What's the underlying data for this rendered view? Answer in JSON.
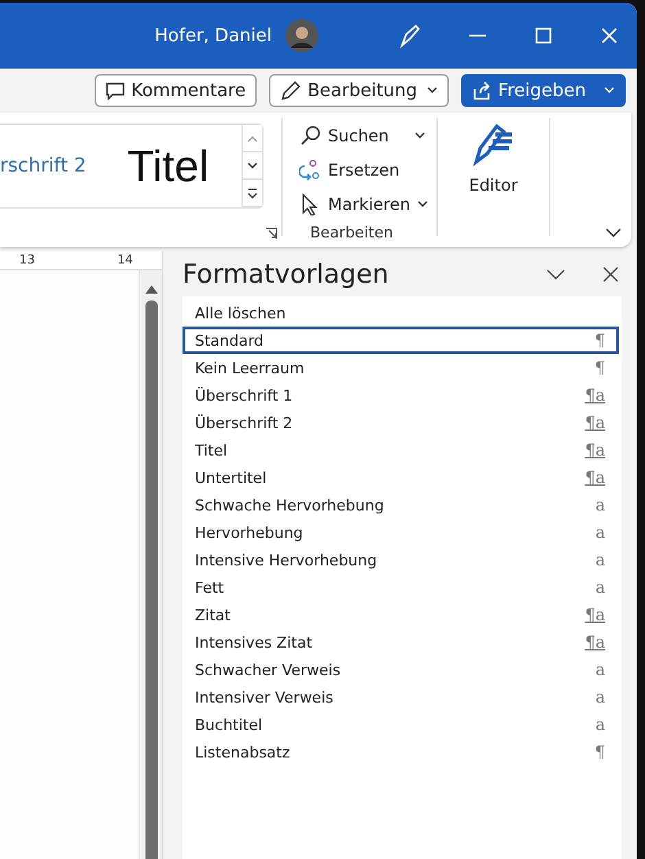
{
  "titlebar": {
    "user": "Hofer, Daniel"
  },
  "commands": [
    {
      "label": "Kommentare",
      "kind": "comments"
    },
    {
      "label": "Bearbeitung",
      "kind": "editing"
    },
    {
      "label": "Freigeben",
      "kind": "share"
    }
  ],
  "ribbon": {
    "gallery": [
      {
        "label": "rschrift 2",
        "kind": "heading"
      },
      {
        "label": "Titel",
        "kind": "title"
      }
    ],
    "edit_group": {
      "items": [
        {
          "label": "Suchen",
          "kind": "find",
          "dropdown": true
        },
        {
          "label": "Ersetzen",
          "kind": "replace",
          "dropdown": false
        },
        {
          "label": "Markieren",
          "kind": "select",
          "dropdown": true
        }
      ],
      "label": "Bearbeiten"
    },
    "editor": {
      "label": "Editor"
    }
  },
  "ruler": [
    "13",
    "14"
  ],
  "styles_pane": {
    "title": "Formatvorlagen",
    "styles": [
      {
        "name": "Alle löschen",
        "selected": false
      },
      {
        "name": "Standard",
        "kind": "paragraph",
        "mark": "¶",
        "selected": true
      },
      {
        "name": "Kein Leerraum",
        "kind": "paragraph",
        "mark": "¶",
        "selected": false
      },
      {
        "name": "Überschrift 1",
        "kind": "linked",
        "mark": "¶a",
        "selected": false
      },
      {
        "name": "Überschrift 2",
        "kind": "linked",
        "mark": "¶a",
        "selected": false
      },
      {
        "name": "Titel",
        "kind": "linked",
        "mark": "¶a",
        "selected": false
      },
      {
        "name": "Untertitel",
        "kind": "linked",
        "mark": "¶a",
        "selected": false
      },
      {
        "name": "Schwache Hervorhebung",
        "kind": "character",
        "mark": "a",
        "selected": false
      },
      {
        "name": "Hervorhebung",
        "kind": "character",
        "mark": "a",
        "selected": false
      },
      {
        "name": "Intensive Hervorhebung",
        "kind": "character",
        "mark": "a",
        "selected": false
      },
      {
        "name": "Fett",
        "kind": "character",
        "mark": "a",
        "selected": false
      },
      {
        "name": "Zitat",
        "kind": "linked",
        "mark": "¶a",
        "selected": false
      },
      {
        "name": "Intensives Zitat",
        "kind": "linked",
        "mark": "¶a",
        "selected": false
      },
      {
        "name": "Schwacher Verweis",
        "kind": "character",
        "mark": "a",
        "selected": false
      },
      {
        "name": "Intensiver Verweis",
        "kind": "character",
        "mark": "a",
        "selected": false
      },
      {
        "name": "Buchtitel",
        "kind": "character",
        "mark": "a",
        "selected": false
      },
      {
        "name": "Listenabsatz",
        "kind": "paragraph",
        "mark": "¶",
        "selected": false
      }
    ]
  }
}
